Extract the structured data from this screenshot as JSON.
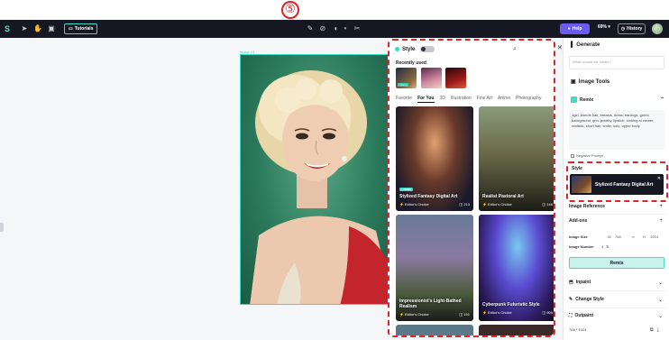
{
  "step_marker": "⑤",
  "toolbar": {
    "tutorials": "Tutorials",
    "help": "Help",
    "zoom": "69%",
    "history": "History"
  },
  "canvas": {
    "image_label": "image 01"
  },
  "style_panel": {
    "title": "Style",
    "recently_used_label": "Recently used",
    "recent_badge": "• Using",
    "tabs": [
      "Favorite",
      "For You",
      "3D",
      "Illustration",
      "Fine Art",
      "Anime",
      "Photography"
    ],
    "active_tab": "For You",
    "cards": [
      {
        "title": "Stylized Fantasy Digital Art",
        "editor": "Editor's Choice",
        "count": "213",
        "badge": "• USING"
      },
      {
        "title": "Realist Pastoral Art",
        "editor": "Editor's Choice",
        "count": "146",
        "badge": ""
      },
      {
        "title": "Impressionist's Light-Bathed Realism",
        "editor": "Editor's Choice",
        "count": "191",
        "badge": ""
      },
      {
        "title": "Cyberpunk Futuristic Style",
        "editor": "Editor's Choice",
        "count": "609",
        "badge": ""
      }
    ]
  },
  "generate_panel": {
    "title": "Generate",
    "input_placeholder": "What should we create?",
    "image_tools": "Image Tools",
    "remix": "Remix",
    "prompt": "1girl, blonde hair, breasts, dress, earrings, green background, grin, jewelry, lipstick, looking at viewer, realistic, short hair, smile, solo, upper body",
    "negative_prompt": "Negative Prompt",
    "style_label": "Style",
    "style_selected": "Stylized Fantasy Digital Art",
    "image_reference": "Image Reference",
    "addons": "Add-ons",
    "image_size": "Image Size",
    "w_label": "W",
    "w_value": "768",
    "h_label": "H",
    "h_value": "1024",
    "image_number": "Image Number",
    "image_number_value": "4",
    "remix_button": "Remix",
    "inpaint": "Inpaint",
    "change_style": "Change Style",
    "outpaint": "Outpaint",
    "footer_size": "768 * 1024"
  }
}
